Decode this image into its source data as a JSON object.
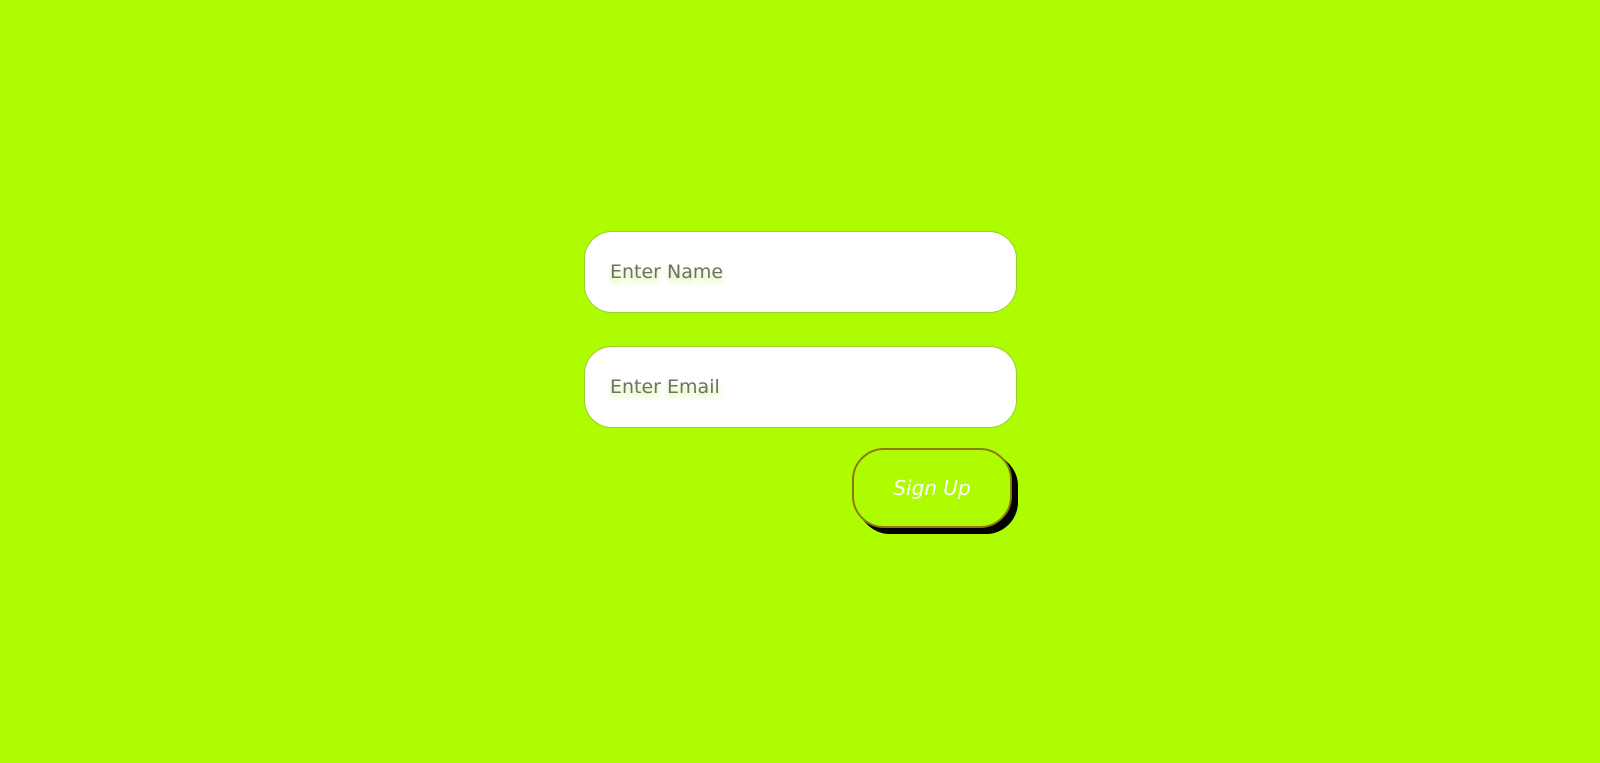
{
  "form": {
    "name_placeholder": "Enter Name",
    "name_value": "",
    "email_placeholder": "Enter Email",
    "email_value": "",
    "submit_label": "Sign Up"
  },
  "colors": {
    "background": "#aefc00",
    "input_bg": "#ffffff",
    "button_text": "#ffffff",
    "button_shadow": "#000000"
  }
}
